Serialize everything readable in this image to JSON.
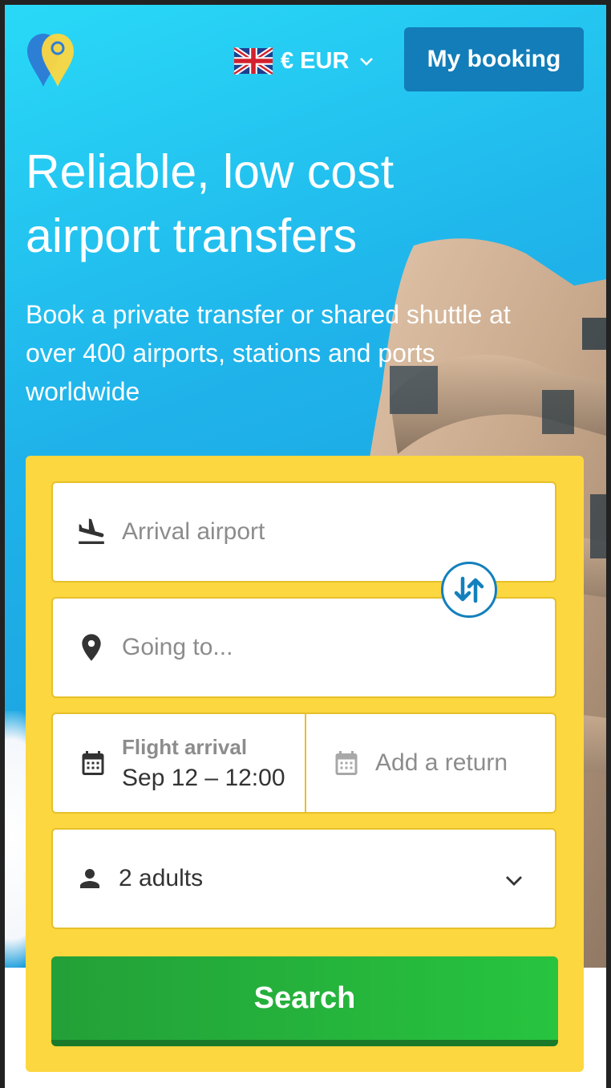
{
  "header": {
    "currency_label": "€ EUR",
    "my_booking_label": "My booking"
  },
  "hero": {
    "title": "Reliable, low cost airport transfers",
    "subtitle": "Book a private transfer or shared shuttle at over 400 airports, stations and ports worldwide"
  },
  "form": {
    "arrival_placeholder": "Arrival airport",
    "destination_placeholder": "Going to...",
    "flight_arrival_label": "Flight arrival",
    "flight_arrival_value": "Sep 12 – 12:00",
    "return_placeholder": "Add a return",
    "passengers_value": "2 adults",
    "search_label": "Search"
  },
  "colors": {
    "sky": "#1fb3ea",
    "panel": "#fdd740",
    "booking_button": "#127db8",
    "search_button": "#27c43f",
    "swap_icon": "#1380bd"
  },
  "icons": [
    "logo-icon",
    "uk-flag-icon",
    "chevron-down-icon",
    "plane-arrival-icon",
    "location-pin-icon",
    "swap-icon",
    "calendar-icon",
    "person-icon"
  ]
}
